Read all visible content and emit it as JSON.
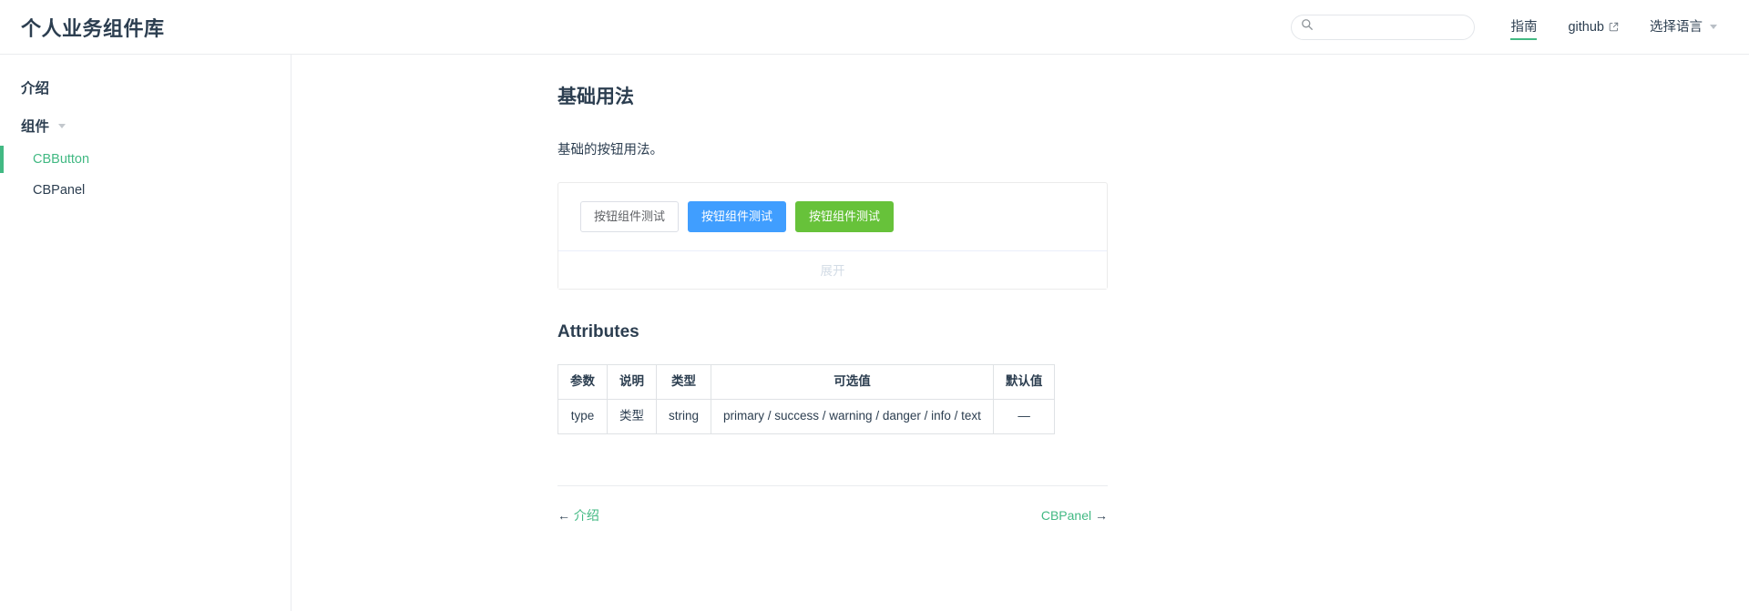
{
  "header": {
    "site_name": "个人业务组件库",
    "search": {
      "placeholder": "",
      "value": "",
      "icon": "search-icon"
    },
    "links": [
      {
        "label": "指南",
        "active": true,
        "external": false
      },
      {
        "label": "github",
        "active": false,
        "external": true
      },
      {
        "label": "选择语言",
        "active": false,
        "dropdown": true
      }
    ]
  },
  "sidebar": {
    "groups": [
      {
        "label": "介绍",
        "has_caret": false,
        "items": []
      },
      {
        "label": "组件",
        "has_caret": true,
        "items": [
          {
            "label": "CBButton",
            "active": true
          },
          {
            "label": "CBPanel",
            "active": false
          }
        ]
      }
    ]
  },
  "main": {
    "title": "基础用法",
    "description": "基础的按钮用法。",
    "demo": {
      "buttons": [
        {
          "label": "按钮组件测试",
          "variant": "default"
        },
        {
          "label": "按钮组件测试",
          "variant": "primary"
        },
        {
          "label": "按钮组件测试",
          "variant": "success"
        }
      ],
      "toggle_label": "展开"
    },
    "attributes": {
      "heading": "Attributes",
      "columns": [
        "参数",
        "说明",
        "类型",
        "可选值",
        "默认值"
      ],
      "rows": [
        [
          "type",
          "类型",
          "string",
          "primary / success / warning / danger / info / text",
          "—"
        ]
      ]
    },
    "page_nav": {
      "prev_arrow": "←",
      "prev_label": "介绍",
      "next_label": "CBPanel",
      "next_arrow": "→"
    }
  },
  "colors": {
    "brand_green": "#42b983",
    "primary_blue": "#409eff",
    "success_green": "#67c23a",
    "text": "#2c3e50",
    "border": "#eaecef"
  }
}
